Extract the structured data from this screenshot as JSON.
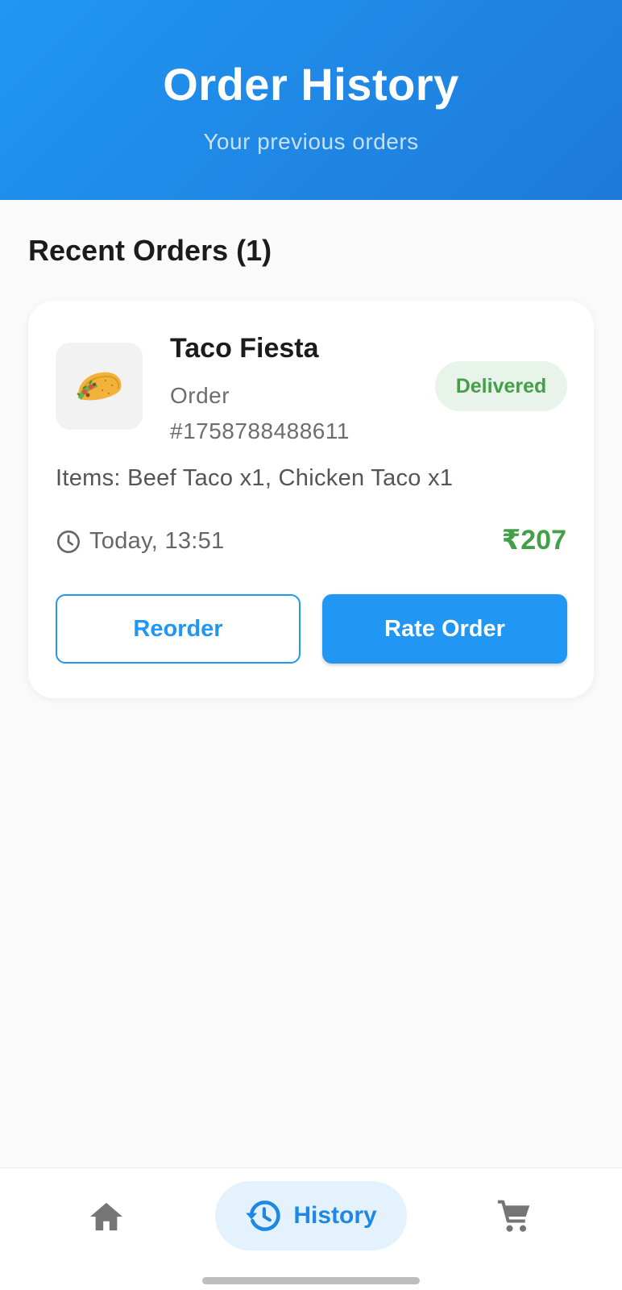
{
  "header": {
    "title": "Order History",
    "subtitle": "Your previous orders"
  },
  "section": {
    "title": "Recent Orders (1)"
  },
  "order": {
    "restaurant": "Taco Fiesta",
    "order_number": "Order #1758788488611",
    "status": "Delivered",
    "items": "Items: Beef Taco x1, Chicken Taco x1",
    "time": "Today, 13:51",
    "price": "₹207",
    "icon": "taco-icon",
    "reorder_label": "Reorder",
    "rate_label": "Rate Order"
  },
  "nav": {
    "items": [
      {
        "icon": "home-icon",
        "label": ""
      },
      {
        "icon": "history-icon",
        "label": "History"
      },
      {
        "icon": "cart-icon",
        "label": ""
      }
    ],
    "active": "History"
  },
  "colors": {
    "primary": "#2196f3",
    "success": "#43a047",
    "success_bg": "#e8f4ea",
    "nav_active_bg": "#e3f2fd"
  }
}
